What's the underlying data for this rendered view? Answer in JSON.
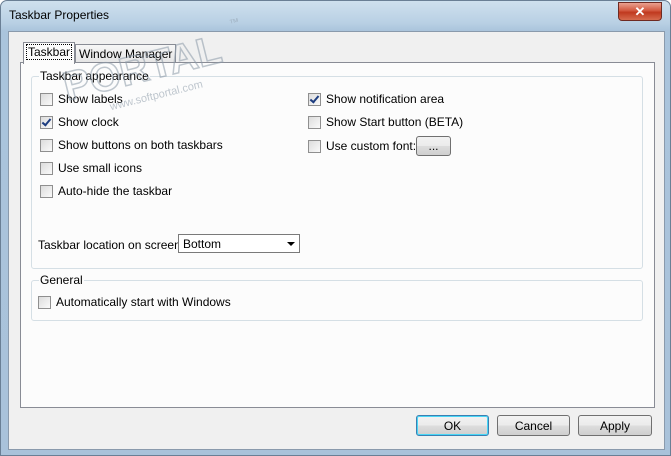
{
  "window": {
    "title": "Taskbar Properties",
    "close_glyph": "✕"
  },
  "tabs": [
    {
      "label": "Taskbar",
      "active": true
    },
    {
      "label": "Window Manager",
      "active": false
    }
  ],
  "appearance": {
    "title": "Taskbar appearance",
    "left_options": [
      {
        "label": "Show labels",
        "checked": false
      },
      {
        "label": "Show clock",
        "checked": true
      },
      {
        "label": "Show buttons on both taskbars",
        "checked": false
      },
      {
        "label": "Use small icons",
        "checked": false
      },
      {
        "label": "Auto-hide the taskbar",
        "checked": false
      }
    ],
    "right_options": [
      {
        "label": "Show notification area",
        "checked": true
      },
      {
        "label": "Show Start button (BETA)",
        "checked": false
      },
      {
        "label": "Use custom font:",
        "checked": false
      }
    ],
    "font_button_label": "...",
    "location_label": "Taskbar location on screen",
    "location_value": "Bottom"
  },
  "general": {
    "title": "General",
    "options": [
      {
        "label": "Automatically start with Windows",
        "checked": false
      }
    ]
  },
  "buttons": {
    "ok": "OK",
    "cancel": "Cancel",
    "apply": "Apply"
  },
  "watermark": {
    "text": "PORTAL",
    "tm": "™",
    "url": "www.softportal.com",
    "color": "#9aa7b4"
  }
}
